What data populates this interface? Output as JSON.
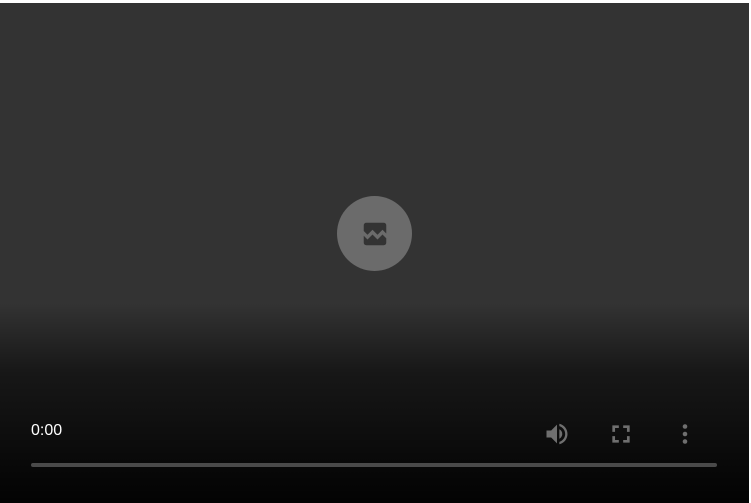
{
  "player": {
    "current_time": "0:00",
    "progress": 0,
    "error_icon": "broken-image-icon",
    "controls": {
      "volume_icon": "volume-icon",
      "fullscreen_icon": "fullscreen-icon",
      "menu_icon": "more-vert-icon"
    },
    "colors": {
      "background": "#333333",
      "icon_circle": "#6b6b6b",
      "control_icon": "#6f6f6f",
      "track": "#4a4a4a"
    }
  }
}
